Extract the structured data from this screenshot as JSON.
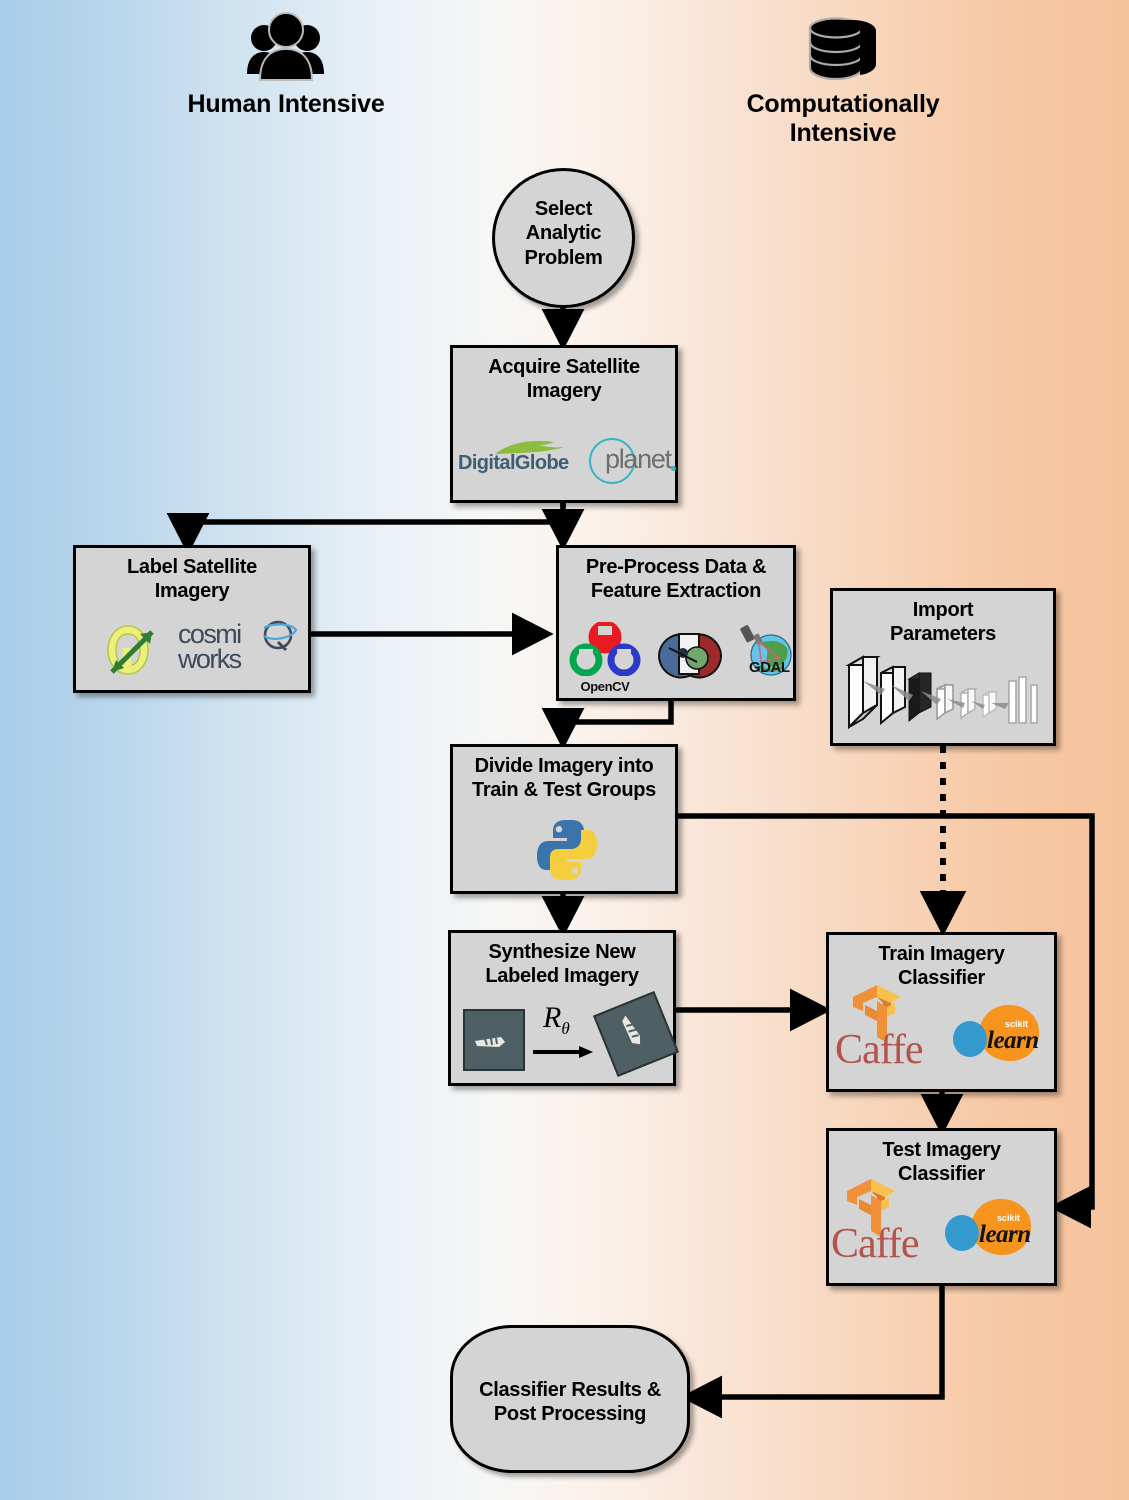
{
  "headers": {
    "left": {
      "label": "Human Intensive",
      "icon": "people-icon"
    },
    "right": {
      "label": "Computationally\nIntensive",
      "line1": "Computationally",
      "line2": "Intensive",
      "icon": "database-icon"
    }
  },
  "nodes": {
    "select_problem": {
      "title": "Select\nAnalytic\nProblem",
      "l1": "Select",
      "l2": "Analytic",
      "l3": "Problem",
      "shape": "circle"
    },
    "acquire": {
      "l1": "Acquire Satellite",
      "l2": "Imagery",
      "shape": "rect",
      "logos": [
        "DigitalGlobe",
        "planet."
      ]
    },
    "label": {
      "l1": "Label Satellite",
      "l2": "Imagery",
      "shape": "rect",
      "logos": [
        "CosmiQ Works"
      ]
    },
    "preprocess": {
      "l1": "Pre-Process Data &",
      "l2": "Feature Extraction",
      "shape": "rect",
      "logos": [
        "OpenCV",
        "scikit-image",
        "GDAL"
      ]
    },
    "import_params": {
      "l1": "Import",
      "l2": "Parameters",
      "shape": "rect",
      "logos": [
        "neural-network-diagram"
      ]
    },
    "divide": {
      "l1": "Divide Imagery into",
      "l2": "Train & Test Groups",
      "shape": "rect",
      "logos": [
        "Python"
      ]
    },
    "synthesize": {
      "l1": "Synthesize New",
      "l2": "Labeled Imagery",
      "shape": "rect",
      "transform_label": "R",
      "transform_sub": "θ",
      "logos": [
        "source-chip",
        "rotated-chip"
      ]
    },
    "train": {
      "l1": "Train Imagery",
      "l2": "Classifier",
      "shape": "rect",
      "logos": [
        "TensorFlow",
        "Caffe",
        "scikit-learn"
      ]
    },
    "test": {
      "l1": "Test Imagery",
      "l2": "Classifier",
      "shape": "rect",
      "logos": [
        "TensorFlow",
        "Caffe",
        "scikit-learn"
      ]
    },
    "results": {
      "l1": "Classifier Results &",
      "l2": "Post Processing",
      "shape": "terminator"
    }
  },
  "logo_text": {
    "digitalglobe": "DigitalGlobe",
    "planet": "planet",
    "planet_dot": ".",
    "cosmiq_1": "cosmi",
    "cosmiq_2": "works",
    "opencv": "OpenCV",
    "gdal": "GDAL",
    "caffe": "Caffe",
    "scikit": "scikit",
    "learn": "learn"
  },
  "colors": {
    "node_fill": "#d4d4d4",
    "node_border": "#000000",
    "bg_left": "#a9cde9",
    "bg_right": "#f6c29c",
    "accent_orange": "#f7941e",
    "accent_blue": "#3499cd",
    "caffe_red": "#b4524c",
    "python_blue": "#3a74ab",
    "python_yellow": "#f5ce3e",
    "tensorflow_orange": "#f0913a",
    "planet_teal": "#35b6c0"
  },
  "edges": [
    {
      "from": "select_problem",
      "to": "acquire",
      "style": "solid"
    },
    {
      "from": "acquire",
      "to": "label",
      "style": "solid"
    },
    {
      "from": "acquire",
      "to": "preprocess",
      "style": "solid"
    },
    {
      "from": "label",
      "to": "preprocess",
      "style": "solid"
    },
    {
      "from": "preprocess",
      "to": "divide",
      "style": "solid"
    },
    {
      "from": "divide",
      "to": "synthesize",
      "style": "solid"
    },
    {
      "from": "divide",
      "to": "test",
      "style": "solid"
    },
    {
      "from": "synthesize",
      "to": "train",
      "style": "solid"
    },
    {
      "from": "import_params",
      "to": "train",
      "style": "dotted"
    },
    {
      "from": "train",
      "to": "test",
      "style": "solid"
    },
    {
      "from": "test",
      "to": "results",
      "style": "solid"
    }
  ]
}
